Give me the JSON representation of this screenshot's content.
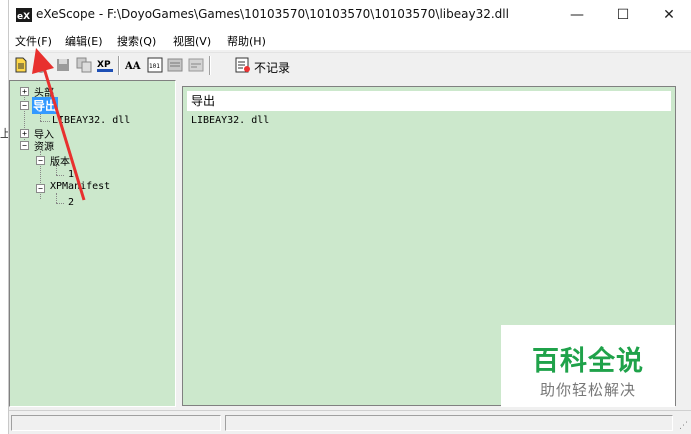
{
  "window": {
    "title": "eXeScope - F:\\DoyoGames\\Games\\10103570\\10103570\\10103570\\libeay32.dll",
    "min_glyph": "—",
    "max_glyph": "☐",
    "close_glyph": "✕"
  },
  "menu": {
    "file": "文件(F)",
    "edit": "编辑(E)",
    "search": "搜索(Q)",
    "view": "视图(V)",
    "help": "帮助(H)"
  },
  "toolbar": {
    "norecord_label": "不记录",
    "icons": [
      "new-icon",
      "fire-icon",
      "save-icon",
      "copy-icon",
      "xp-icon",
      "font-icon",
      "resource-icon",
      "export-icon",
      "import-icon",
      "norecord-icon"
    ]
  },
  "tree": {
    "header": "头部",
    "export": "导出",
    "export_child": "LIBEAY32. dll",
    "import": "导入",
    "resources": "资源",
    "version": "版本",
    "version_child": "1",
    "xpmanifest": "XPManifest",
    "xpmanifest_child": "2"
  },
  "leftfrag": "上",
  "rightpane": {
    "header": "导出",
    "row": "LIBEAY32. dll"
  },
  "watermark": {
    "title": "百科全说",
    "subtitle": "助你轻松解决"
  },
  "colors": {
    "pane_bg": "#cce8cc",
    "selection": "#3399ff",
    "arrow": "#e8302e",
    "watermark_green": "#1fa24a"
  }
}
